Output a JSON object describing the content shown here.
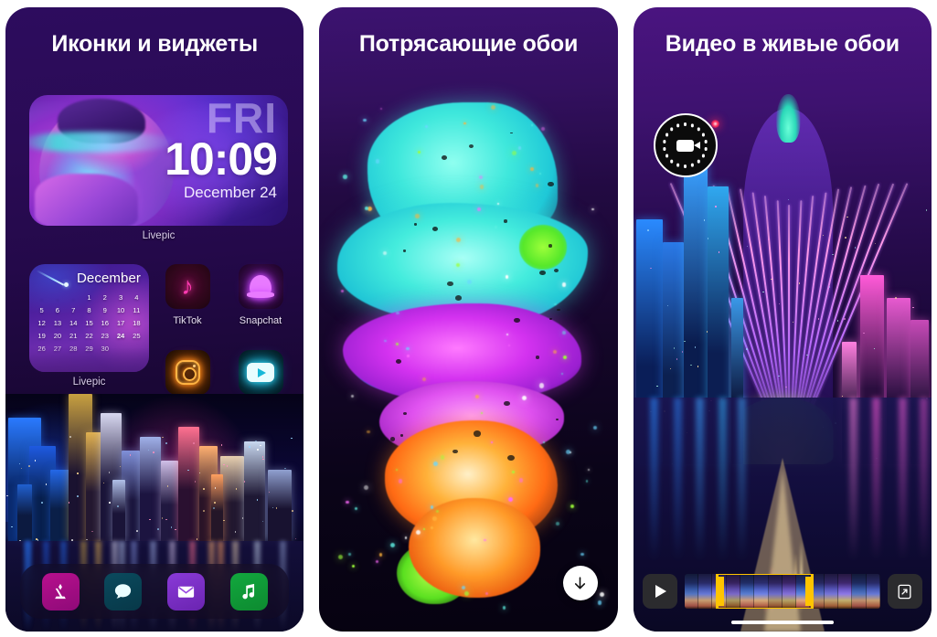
{
  "panels": [
    {
      "id": "icons-widgets",
      "title": "Иконки и виджеты",
      "clock_widget": {
        "weekday": "FRI",
        "time": "10:09",
        "date": "December 24",
        "label": "Livepic"
      },
      "calendar_widget": {
        "month": "December",
        "days": [
          1,
          2,
          3,
          4,
          5,
          6,
          7,
          8,
          9,
          10,
          11,
          12,
          13,
          14,
          15,
          16,
          17,
          18,
          19,
          20,
          21,
          22,
          23,
          24,
          25,
          26,
          27,
          28,
          29,
          30
        ],
        "lead_blanks": 3,
        "today": 24,
        "label": "Livepic",
        "highlight_color": "#ff3fc8"
      },
      "apps": [
        {
          "name": "TikTok",
          "icon": "tiktok-icon"
        },
        {
          "name": "Snapchat",
          "icon": "snapchat-icon"
        },
        {
          "name": "Instagram",
          "icon": "instagram-icon"
        },
        {
          "name": "YouTube",
          "icon": "youtube-icon"
        }
      ],
      "dock": [
        {
          "name": "App Store",
          "icon": "app-store-icon",
          "color": "#b8108e"
        },
        {
          "name": "Messages",
          "icon": "messages-icon",
          "color": "#0a4a5e"
        },
        {
          "name": "Mail",
          "icon": "mail-icon",
          "color": "#8a3ad8"
        },
        {
          "name": "Music",
          "icon": "music-icon",
          "color": "#12a83e"
        }
      ]
    },
    {
      "id": "wallpapers",
      "title": "Потрясающие обои",
      "download_button": {
        "icon": "download-arrow-icon"
      }
    },
    {
      "id": "video-live-wallpaper",
      "title": "Видео в живые обои",
      "camera_button": {
        "icon": "video-camera-icon"
      },
      "timeline": {
        "play": "play-icon",
        "crop": "crop-resize-icon",
        "trim_color": "#ffc400",
        "frames": 14,
        "selection_start_pct": 16,
        "selection_width_pct": 50
      }
    }
  ],
  "colors": {
    "background": "#ffffff",
    "panel_purple": "#3c1270",
    "accent_pink": "#ff3fc8",
    "accent_cyan": "#3fe8dc",
    "trim_yellow": "#ffc400"
  }
}
